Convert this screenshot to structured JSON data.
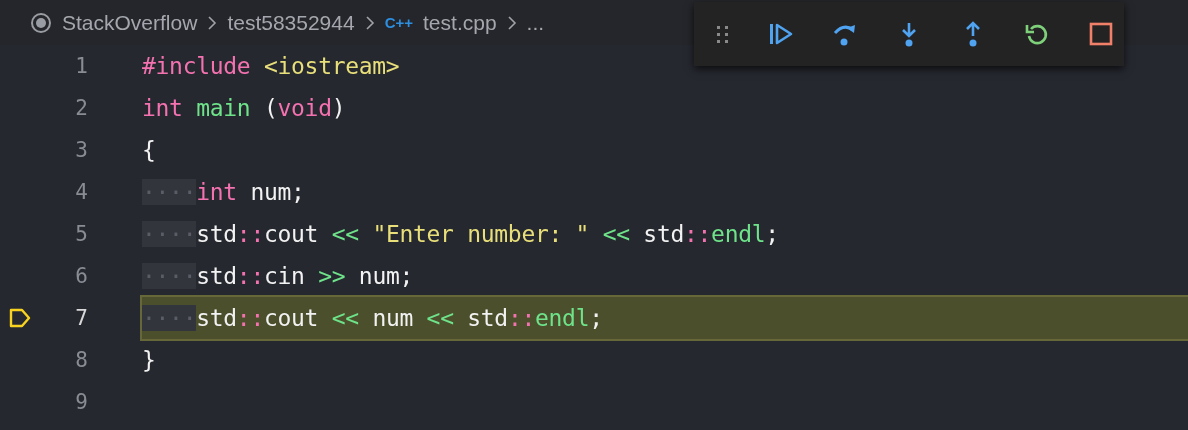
{
  "breadcrumbs": [
    {
      "kind": "root",
      "label": "StackOverflow"
    },
    {
      "kind": "folder",
      "label": "test58352944"
    },
    {
      "kind": "file",
      "badge": "C++",
      "label": "test.cpp"
    },
    {
      "kind": "more",
      "label": "..."
    }
  ],
  "debug_toolbar": {
    "buttons": [
      {
        "kind": "grip"
      },
      {
        "kind": "continue"
      },
      {
        "kind": "step-over"
      },
      {
        "kind": "step-into"
      },
      {
        "kind": "step-out"
      },
      {
        "kind": "restart"
      },
      {
        "kind": "stop"
      }
    ]
  },
  "lines": [
    {
      "number": "1",
      "current": false,
      "tokens": [
        {
          "kind": "keyword",
          "text": "#include "
        },
        {
          "kind": "string",
          "text": "<iostream>"
        }
      ]
    },
    {
      "number": "2",
      "current": false,
      "tokens": [
        {
          "kind": "keyword",
          "text": "int "
        },
        {
          "kind": "function",
          "text": "main"
        },
        {
          "kind": "plain",
          "text": " ("
        },
        {
          "kind": "keyword",
          "text": "void"
        },
        {
          "kind": "plain",
          "text": ")"
        }
      ]
    },
    {
      "number": "3",
      "current": false,
      "tokens": [
        {
          "kind": "plain",
          "text": "{"
        }
      ]
    },
    {
      "number": "4",
      "current": false,
      "tokens": [
        {
          "kind": "whitespace",
          "text": "····"
        },
        {
          "kind": "keyword",
          "text": "int"
        },
        {
          "kind": "plain",
          "text": " num;"
        }
      ]
    },
    {
      "number": "5",
      "current": false,
      "tokens": [
        {
          "kind": "whitespace",
          "text": "····"
        },
        {
          "kind": "plain",
          "text": "std"
        },
        {
          "kind": "keyword",
          "text": "::"
        },
        {
          "kind": "plain",
          "text": "cout "
        },
        {
          "kind": "operator",
          "text": "<< "
        },
        {
          "kind": "string",
          "text": "\"Enter number: \""
        },
        {
          "kind": "operator",
          "text": " <<"
        },
        {
          "kind": "plain",
          "text": " std"
        },
        {
          "kind": "keyword",
          "text": "::"
        },
        {
          "kind": "function",
          "text": "endl"
        },
        {
          "kind": "plain",
          "text": ";"
        }
      ]
    },
    {
      "number": "6",
      "current": false,
      "tokens": [
        {
          "kind": "whitespace",
          "text": "····"
        },
        {
          "kind": "plain",
          "text": "std"
        },
        {
          "kind": "keyword",
          "text": "::"
        },
        {
          "kind": "plain",
          "text": "cin "
        },
        {
          "kind": "operator",
          "text": ">>"
        },
        {
          "kind": "plain",
          "text": " num;"
        }
      ]
    },
    {
      "number": "7",
      "current": true,
      "tokens": [
        {
          "kind": "whitespace",
          "text": "····"
        },
        {
          "kind": "plain",
          "text": "std"
        },
        {
          "kind": "keyword",
          "text": "::"
        },
        {
          "kind": "plain",
          "text": "cout "
        },
        {
          "kind": "operator",
          "text": "<<"
        },
        {
          "kind": "plain",
          "text": " num "
        },
        {
          "kind": "operator",
          "text": "<<"
        },
        {
          "kind": "plain",
          "text": " std"
        },
        {
          "kind": "keyword",
          "text": "::"
        },
        {
          "kind": "function",
          "text": "endl"
        },
        {
          "kind": "plain",
          "text": ";"
        }
      ]
    },
    {
      "number": "8",
      "current": false,
      "tokens": [
        {
          "kind": "plain",
          "text": "}"
        }
      ]
    },
    {
      "number": "9",
      "current": false
    }
  ]
}
